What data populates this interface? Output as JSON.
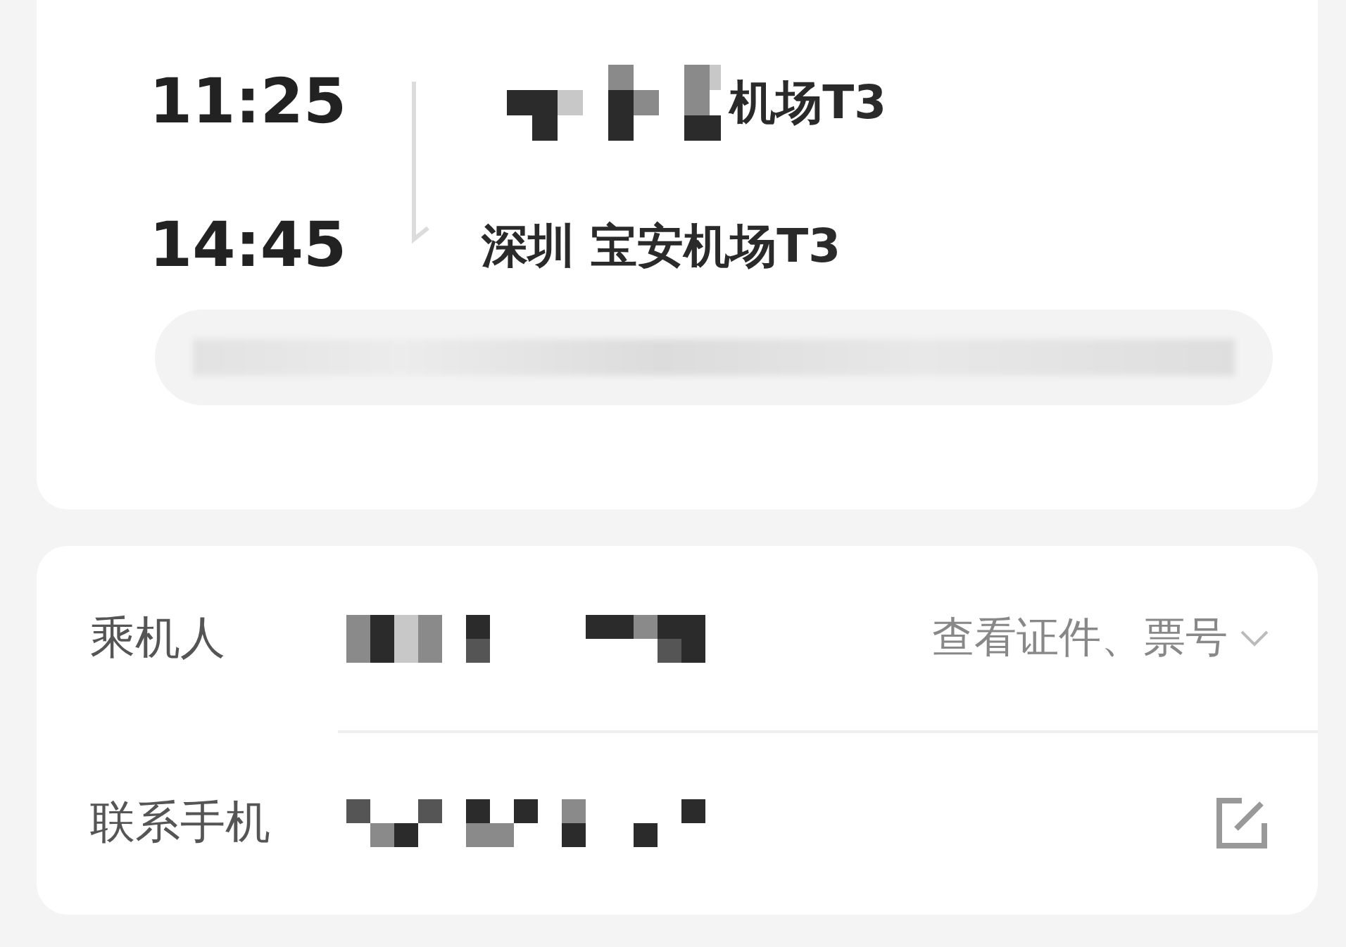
{
  "flight": {
    "departure": {
      "time": "11:25",
      "airport": "机场T3"
    },
    "arrival": {
      "time": "14:45",
      "city": "深圳",
      "airport": "宝安机场T3"
    }
  },
  "passenger_info": {
    "rows": [
      {
        "kind": "passenger",
        "label": "乘机人",
        "action": "查看证件、票号"
      },
      {
        "kind": "contact",
        "label": "联系手机"
      }
    ]
  }
}
